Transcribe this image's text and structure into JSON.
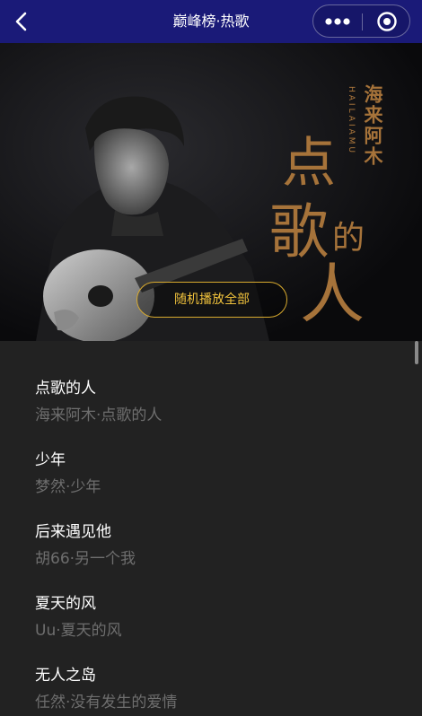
{
  "navbar": {
    "title": "巅峰榜·热歌",
    "back_icon": "chevron-left-icon",
    "more_icon": "more-dots-icon",
    "close_icon": "target-circle-icon",
    "background_color": "#1a1a78"
  },
  "banner": {
    "artist_pinyin": "HAILAIAMU",
    "artist_name": "海来阿木",
    "album_title": "点歌的人",
    "play_all_label": "随机播放全部",
    "accent_color": "#f0c23c",
    "art_text_color": "#a6733a"
  },
  "songs": [
    {
      "title": "点歌的人",
      "subtitle": "海来阿木·点歌的人"
    },
    {
      "title": "少年",
      "subtitle": "梦然·少年"
    },
    {
      "title": "后来遇见他",
      "subtitle": "胡66·另一个我"
    },
    {
      "title": "夏天的风",
      "subtitle": "Uu·夏天的风"
    },
    {
      "title": "无人之岛",
      "subtitle": "任然·没有发生的爱情"
    }
  ]
}
